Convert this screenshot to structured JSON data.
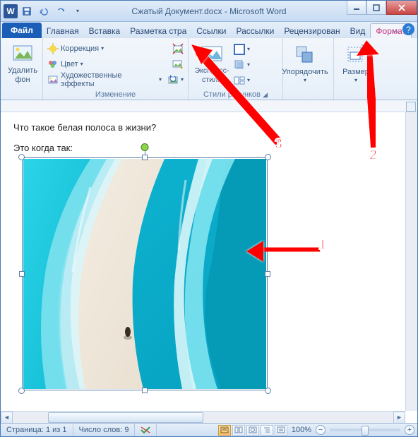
{
  "titlebar": {
    "app_icon_text": "W",
    "title": "Сжатый Документ.docx - Microsoft Word"
  },
  "tabs": {
    "file": "Файл",
    "items": [
      "Главная",
      "Вставка",
      "Разметка стра",
      "Ссылки",
      "Рассылки",
      "Рецензирован",
      "Вид"
    ],
    "contextual": "Формат"
  },
  "ribbon": {
    "remove_bg": "Удалить\nфон",
    "correction": "Коррекция",
    "color": "Цвет",
    "artistic": "Художественные эффекты",
    "group_adjust": "Изменение",
    "express_styles": "Экспресс-стили",
    "group_styles": "Стили рисунков",
    "arrange": "Упорядочить",
    "size": "Размер"
  },
  "document": {
    "line1": "Что такое белая полоса в жизни?",
    "line2": "Это когда так:"
  },
  "status": {
    "page": "Страница: 1 из 1",
    "words": "Число слов: 9",
    "zoom": "100%"
  },
  "annotations": {
    "a1": "1",
    "a2": "2",
    "a3": "3"
  }
}
